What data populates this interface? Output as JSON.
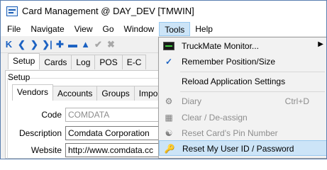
{
  "window": {
    "title": "Card Management @ DAY_DEV [TMWIN]"
  },
  "menubar": {
    "items": [
      {
        "label": "File"
      },
      {
        "label": "Navigate"
      },
      {
        "label": "View"
      },
      {
        "label": "Go"
      },
      {
        "label": "Window"
      },
      {
        "label": "Tools"
      },
      {
        "label": "Help"
      }
    ]
  },
  "toolbar": {
    "icons": [
      "first-icon",
      "prev-icon",
      "next-icon",
      "last-icon",
      "add-icon",
      "delete-icon",
      "up-icon",
      "confirm-icon",
      "cancel-icon"
    ]
  },
  "tabs_top": [
    "Setup",
    "Cards",
    "Log",
    "POS",
    "E-C"
  ],
  "group_label": "Setup",
  "tabs_inner": [
    "Vendors",
    "Accounts",
    "Groups",
    "Import"
  ],
  "form": {
    "code_label": "Code",
    "code_value": "COMDATA",
    "description_label": "Description",
    "description_value": "Comdata Corporation",
    "website_label": "Website",
    "website_value": "http://www.comdata.cc"
  },
  "tools_menu": {
    "truckmate_monitor": "TruckMate Monitor...",
    "remember_position": "Remember Position/Size",
    "reload_settings": "Reload Application Settings",
    "diary": "Diary",
    "diary_shortcut": "Ctrl+D",
    "clear_deassign": "Clear / De-assign",
    "reset_pin": "Reset Card's Pin Number",
    "reset_user": "Reset My User ID / Password"
  },
  "colors": {
    "accent": "#1c62c2",
    "highlight": "#cce4f7",
    "border_highlight": "#99c9ef"
  }
}
